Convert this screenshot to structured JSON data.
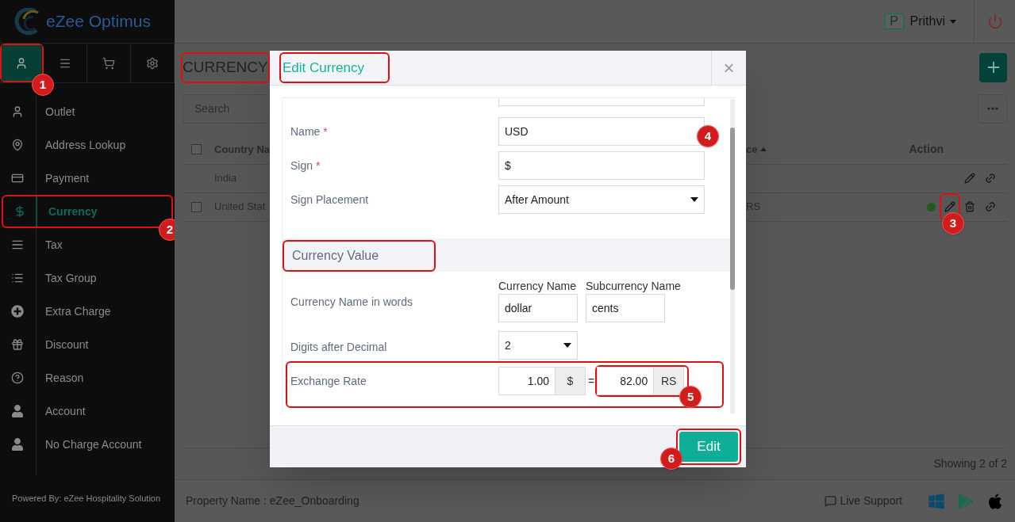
{
  "brand": {
    "name": "eZee Optimus"
  },
  "sidebar": {
    "tabs": [
      {
        "selected": true,
        "highlighted": true,
        "callout": "1"
      },
      {
        "selected": false
      },
      {
        "selected": false
      },
      {
        "selected": false
      }
    ],
    "items": [
      {
        "label": "Outlet",
        "selected": false
      },
      {
        "label": "Address Lookup",
        "selected": false
      },
      {
        "label": "Payment",
        "selected": false
      },
      {
        "label": "Currency",
        "selected": true,
        "highlighted": true,
        "callout": "2"
      },
      {
        "label": "Tax",
        "selected": false
      },
      {
        "label": "Tax Group",
        "selected": false
      },
      {
        "label": "Extra Charge",
        "selected": false
      },
      {
        "label": "Discount",
        "selected": false
      },
      {
        "label": "Reason",
        "selected": false
      },
      {
        "label": "Account",
        "selected": false
      },
      {
        "label": "No Charge Account",
        "selected": false
      }
    ],
    "footer": "Powered By: eZee Hospitality Solution"
  },
  "header": {
    "user_initial": "P",
    "user_name": "Prithvi"
  },
  "page": {
    "title": "CURRENCY",
    "title_highlighted": true,
    "search": {
      "placeholder": "Search"
    },
    "table": {
      "select_all_checked": false,
      "columns": [
        {
          "label": "Country Na"
        },
        {
          "label": "ce",
          "sorted": true
        },
        {
          "label": "Action"
        }
      ],
      "rows": [
        {
          "country": "India",
          "column_2": "",
          "active": false,
          "deletable": false
        },
        {
          "country": "United Stat",
          "column_2": "RS",
          "checked": false,
          "active": true,
          "deletable": true,
          "edit_highlighted": true,
          "edit_callout": "3"
        }
      ]
    },
    "status": "Showing 2 of 2"
  },
  "footer": {
    "property": "Property Name : eZee_Onboarding",
    "support": "Live Support"
  },
  "modal": {
    "title": "Edit Currency",
    "title_highlighted": true,
    "close": "×",
    "required_mark": "*",
    "fields": [
      {
        "kind": "text",
        "label": "Name",
        "value": "USD",
        "required": true,
        "callout": "4"
      },
      {
        "kind": "text",
        "label": "Sign",
        "value": "$",
        "required": true
      },
      {
        "kind": "select",
        "label": "Sign Placement",
        "value": "After Amount",
        "required": false
      }
    ],
    "section": {
      "title": "Currency Value",
      "highlighted": true
    },
    "words": {
      "label": "Currency Name in words",
      "currency_label": "Currency Name",
      "currency_value": "dollar",
      "sub_label": "Subcurrency Name",
      "sub_value": "cents"
    },
    "digits": {
      "label": "Digits after Decimal",
      "value": "2"
    },
    "exchange": {
      "label": "Exchange Rate",
      "highlighted": true,
      "from_value": "1.00",
      "from_unit": "$",
      "equals": "=",
      "to_value": "82.00",
      "to_unit": "RS",
      "to_highlighted": true,
      "to_callout": "5"
    },
    "submit": {
      "label": "Edit",
      "highlighted": true,
      "callout": "6"
    }
  }
}
